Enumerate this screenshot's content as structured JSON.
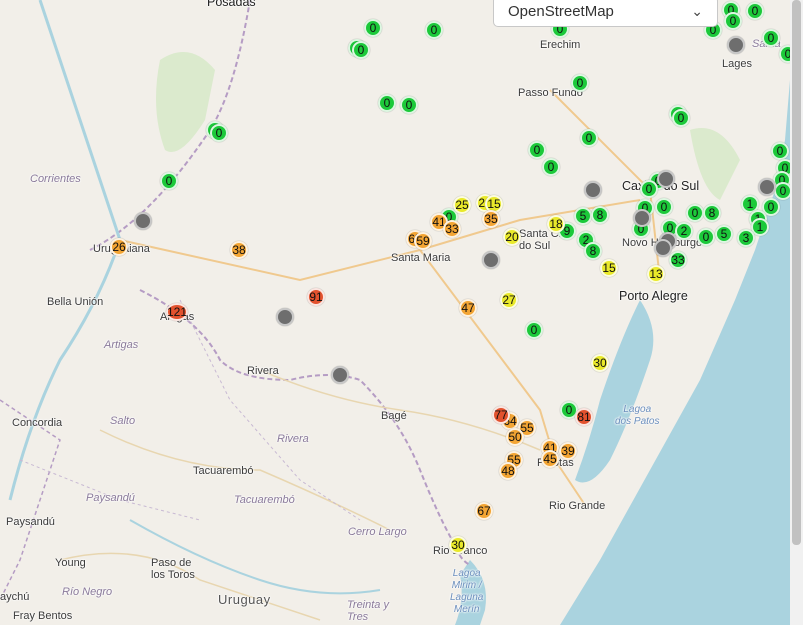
{
  "layer_select": {
    "selected": "OpenStreetMap",
    "options": [
      "OpenStreetMap"
    ]
  },
  "colors": {
    "green": "#1cc93a",
    "yellow": "#e9e92a",
    "orange": "#f3a534",
    "red": "#e2522e",
    "gray": "#6e6e6e"
  },
  "places": [
    {
      "id": "posadas",
      "text": "Posadas",
      "cls": "big"
    },
    {
      "id": "erechim",
      "text": "Erechim",
      "cls": ""
    },
    {
      "id": "lages",
      "text": "Lages",
      "cls": ""
    },
    {
      "id": "santa",
      "text": "Santa",
      "cls": "region"
    },
    {
      "id": "passo-fundo",
      "text": "Passo Fundo",
      "cls": ""
    },
    {
      "id": "corrientes",
      "text": "Corrientes",
      "cls": "region"
    },
    {
      "id": "uruguaiana",
      "text": "Uruguaiana",
      "cls": ""
    },
    {
      "id": "caxias",
      "text": "Caxias do Sul",
      "cls": "big"
    },
    {
      "id": "novo-hamburgo",
      "text": "Novo Hamburgo",
      "cls": ""
    },
    {
      "id": "santa-cruz",
      "text": "Santa Cruz do Sul",
      "cls": ""
    },
    {
      "id": "santa-maria",
      "text": "Santa Maria",
      "cls": ""
    },
    {
      "id": "porto-alegre",
      "text": "Porto Alegre",
      "cls": "big"
    },
    {
      "id": "bella-union",
      "text": "Bella Unión",
      "cls": ""
    },
    {
      "id": "artigas-city",
      "text": "Artigas",
      "cls": ""
    },
    {
      "id": "artigas-dept",
      "text": "Artigas",
      "cls": "region"
    },
    {
      "id": "rivera-city",
      "text": "Rivera",
      "cls": ""
    },
    {
      "id": "rivera-dept",
      "text": "Rivera",
      "cls": "region"
    },
    {
      "id": "salto",
      "text": "Salto",
      "cls": "region"
    },
    {
      "id": "concordia",
      "text": "Concordia",
      "cls": ""
    },
    {
      "id": "bage",
      "text": "Bagé",
      "cls": ""
    },
    {
      "id": "pelotas",
      "text": "Pelotas",
      "cls": ""
    },
    {
      "id": "lagoa-patos",
      "text": "Lagoa dos Patos",
      "cls": "water"
    },
    {
      "id": "tacuarembo-city",
      "text": "Tacuarembó",
      "cls": ""
    },
    {
      "id": "tacuarembo-dept",
      "text": "Tacuarembó",
      "cls": "region"
    },
    {
      "id": "paysandu-dept",
      "text": "Paysandú",
      "cls": "region"
    },
    {
      "id": "paysandu-city",
      "text": "Paysandú",
      "cls": ""
    },
    {
      "id": "rio-grande",
      "text": "Rio Grande",
      "cls": ""
    },
    {
      "id": "cerro-largo",
      "text": "Cerro Largo",
      "cls": "region"
    },
    {
      "id": "rio-branco",
      "text": "Rio Branco",
      "cls": ""
    },
    {
      "id": "young",
      "text": "Young",
      "cls": ""
    },
    {
      "id": "paso-toros",
      "text": "Paso de los Toros",
      "cls": ""
    },
    {
      "id": "rio-negro",
      "text": "Río Negro",
      "cls": "region"
    },
    {
      "id": "uruguay",
      "text": "Uruguay",
      "cls": "country"
    },
    {
      "id": "treinta-tres",
      "text": "Treinta y Tres",
      "cls": "region"
    },
    {
      "id": "lagoa-mirim",
      "text": "Lagoa Mirim / Laguna Merín",
      "cls": "water"
    },
    {
      "id": "gualeguaychu",
      "text": "aychú",
      "cls": ""
    },
    {
      "id": "fray-bentos",
      "text": "Fray Bentos",
      "cls": ""
    }
  ],
  "markers": [
    {
      "v": "0",
      "c": "green"
    },
    {
      "v": "0",
      "c": "green"
    },
    {
      "v": "0",
      "c": "green"
    },
    {
      "v": "0",
      "c": "green"
    },
    {
      "v": "0",
      "c": "green"
    },
    {
      "v": "0",
      "c": "green"
    },
    {
      "v": "0",
      "c": "green"
    },
    {
      "v": "0",
      "c": "green"
    },
    {
      "v": "0",
      "c": "green"
    },
    {
      "v": "0",
      "c": "green"
    },
    {
      "v": "0",
      "c": "green"
    },
    {
      "v": "0",
      "c": "green"
    },
    {
      "v": "0",
      "c": "green"
    },
    {
      "v": "0",
      "c": "green"
    },
    {
      "v": "0",
      "c": "green"
    },
    {
      "v": "0",
      "c": "green"
    },
    {
      "v": "0",
      "c": "green"
    },
    {
      "v": "0",
      "c": "green"
    },
    {
      "v": "0",
      "c": "green"
    },
    {
      "v": "0",
      "c": "green"
    },
    {
      "v": "0",
      "c": "green"
    },
    {
      "v": "0",
      "c": "green"
    },
    {
      "v": "0",
      "c": "green"
    },
    {
      "v": "0",
      "c": "green"
    },
    {
      "v": "0",
      "c": "green"
    },
    {
      "v": "0",
      "c": "green"
    },
    {
      "v": "0",
      "c": "green"
    },
    {
      "v": "0",
      "c": "green"
    },
    {
      "v": "0",
      "c": "green"
    },
    {
      "v": "0",
      "c": "green"
    },
    {
      "v": "0",
      "c": "green"
    },
    {
      "v": "0",
      "c": "green"
    },
    {
      "v": "0",
      "c": "green"
    },
    {
      "v": "0",
      "c": "green"
    },
    {
      "v": "0",
      "c": "green"
    },
    {
      "v": "0",
      "c": "green"
    },
    {
      "v": "0",
      "c": "green"
    },
    {
      "v": "0",
      "c": "green"
    },
    {
      "v": "1",
      "c": "green"
    },
    {
      "v": "1",
      "c": "green"
    },
    {
      "v": "1",
      "c": "green"
    },
    {
      "v": "2",
      "c": "green"
    },
    {
      "v": "3",
      "c": "green"
    },
    {
      "v": "5",
      "c": "green"
    },
    {
      "v": "5",
      "c": "green"
    },
    {
      "v": "8",
      "c": "green"
    },
    {
      "v": "8",
      "c": "green"
    },
    {
      "v": "8",
      "c": "green"
    },
    {
      "v": "9",
      "c": "green"
    },
    {
      "v": "2",
      "c": "green"
    },
    {
      "v": "33",
      "c": "green"
    },
    {
      "v": "25",
      "c": "yellow"
    },
    {
      "v": "26",
      "c": "yellow"
    },
    {
      "v": "15",
      "c": "yellow"
    },
    {
      "v": "18",
      "c": "yellow"
    },
    {
      "v": "20",
      "c": "yellow"
    },
    {
      "v": "15",
      "c": "yellow"
    },
    {
      "v": "27",
      "c": "yellow"
    },
    {
      "v": "30",
      "c": "yellow"
    },
    {
      "v": "30",
      "c": "yellow"
    },
    {
      "v": "13",
      "c": "yellow"
    },
    {
      "v": "26",
      "c": "orange"
    },
    {
      "v": "38",
      "c": "orange"
    },
    {
      "v": "41",
      "c": "orange"
    },
    {
      "v": "33",
      "c": "orange"
    },
    {
      "v": "35",
      "c": "orange"
    },
    {
      "v": "65",
      "c": "orange"
    },
    {
      "v": "59",
      "c": "orange"
    },
    {
      "v": "47",
      "c": "orange"
    },
    {
      "v": "64",
      "c": "orange"
    },
    {
      "v": "55",
      "c": "orange"
    },
    {
      "v": "50",
      "c": "orange"
    },
    {
      "v": "41",
      "c": "orange"
    },
    {
      "v": "39",
      "c": "orange"
    },
    {
      "v": "45",
      "c": "orange"
    },
    {
      "v": "55",
      "c": "orange"
    },
    {
      "v": "48",
      "c": "orange"
    },
    {
      "v": "67",
      "c": "orange"
    },
    {
      "v": "91",
      "c": "red"
    },
    {
      "v": "121",
      "c": "red"
    },
    {
      "v": "77",
      "c": "red"
    },
    {
      "v": "81",
      "c": "red"
    },
    {
      "v": "",
      "c": "gray"
    },
    {
      "v": "",
      "c": "gray"
    },
    {
      "v": "",
      "c": "gray"
    },
    {
      "v": "",
      "c": "gray"
    },
    {
      "v": "",
      "c": "gray"
    },
    {
      "v": "",
      "c": "gray"
    },
    {
      "v": "",
      "c": "gray"
    },
    {
      "v": "",
      "c": "gray"
    },
    {
      "v": "",
      "c": "gray"
    },
    {
      "v": "",
      "c": "gray"
    },
    {
      "v": "",
      "c": "gray"
    }
  ]
}
